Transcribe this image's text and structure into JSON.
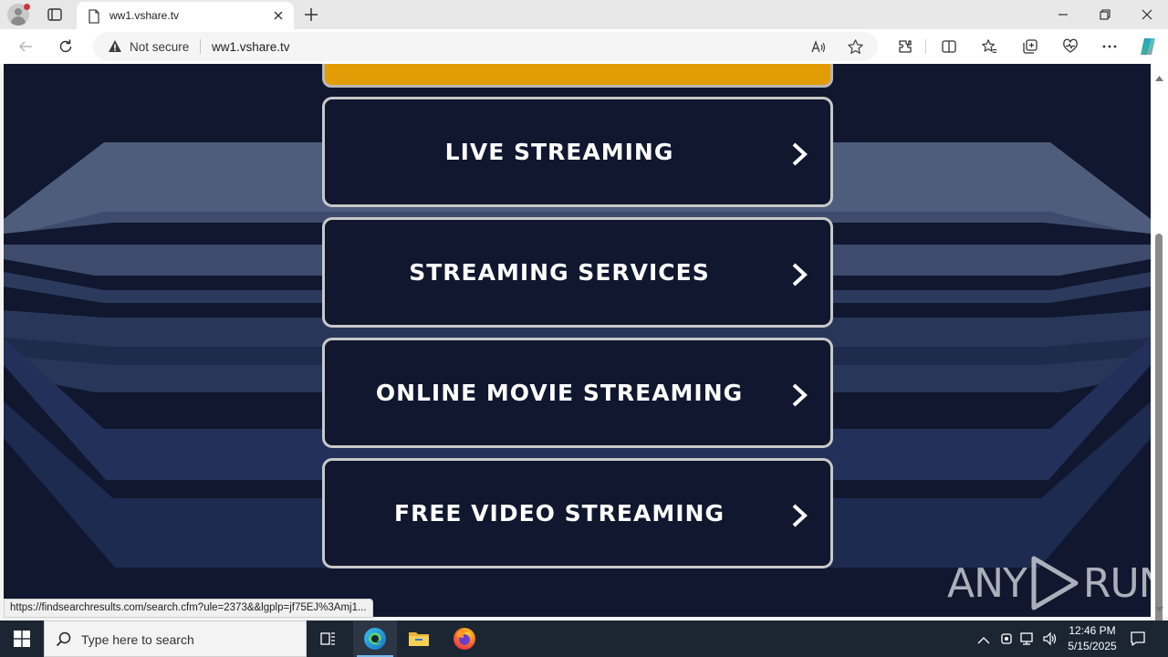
{
  "browser": {
    "tab_title": "ww1.vshare.tv",
    "security_label": "Not secure",
    "url": "ww1.vshare.tv",
    "status_url": "https://findsearchresults.com/search.cfm?ule=2373&&lgplp=jf75EJ%3Amj1..."
  },
  "page": {
    "buttons": [
      {
        "label": "LIVE STREAMING"
      },
      {
        "label": "STREAMING SERVICES"
      },
      {
        "label": "ONLINE MOVIE STREAMING"
      },
      {
        "label": "FREE VIDEO STREAMING"
      }
    ],
    "watermark": {
      "left": "ANY",
      "right": "RUN"
    },
    "colors": {
      "background": "#10172e",
      "accent": "#e19c06",
      "button_border": "#c8c8c8"
    }
  },
  "taskbar": {
    "search_placeholder": "Type here to search",
    "time": "12:46 PM",
    "date": "5/15/2025"
  }
}
